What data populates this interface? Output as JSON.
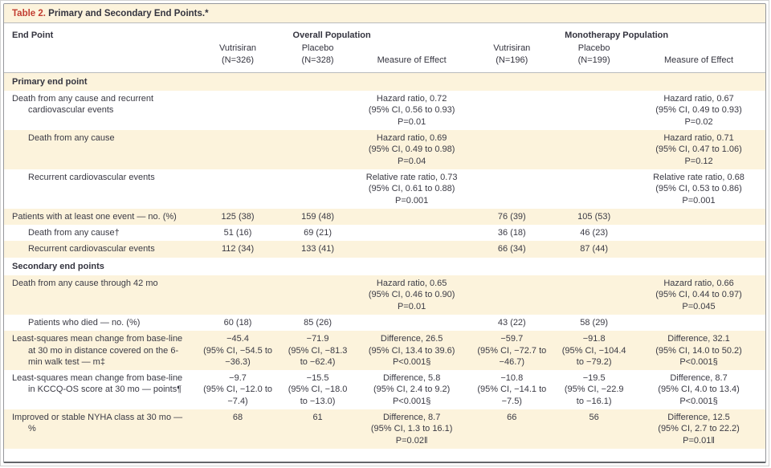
{
  "title": {
    "label": "Table 2.",
    "text": " Primary and Secondary End Points.*"
  },
  "colors": {
    "accent_red": "#c23d31",
    "row_shade": "#fcf3dc",
    "text": "#3a3a44",
    "border": "#95979b"
  },
  "header": {
    "end_point": "End Point",
    "groups": [
      {
        "label": "Overall Population"
      },
      {
        "label": "Monotherapy Population"
      }
    ],
    "columns": [
      "Vutrisiran\n(N=326)",
      "Placebo\n(N=328)",
      "Measure of Effect",
      "Vutrisiran\n(N=196)",
      "Placebo\n(N=199)",
      "Measure of Effect"
    ]
  },
  "rows": [
    {
      "type": "section",
      "label": "Primary end point",
      "shade": true
    },
    {
      "type": "data",
      "indent": 0,
      "shade": false,
      "label": "Death from any cause and recurrent cardiovascular events",
      "cells": [
        "",
        "",
        "Hazard ratio, 0.72\n(95% CI, 0.56 to 0.93)\nP=0.01",
        "",
        "",
        "Hazard ratio, 0.67\n(95% CI, 0.49 to 0.93)\nP=0.02"
      ]
    },
    {
      "type": "data",
      "indent": 1,
      "shade": true,
      "label": "Death from any cause",
      "cells": [
        "",
        "",
        "Hazard ratio, 0.69\n(95% CI, 0.49 to 0.98)\nP=0.04",
        "",
        "",
        "Hazard ratio, 0.71\n(95% CI, 0.47 to 1.06)\nP=0.12"
      ]
    },
    {
      "type": "data",
      "indent": 1,
      "shade": false,
      "label": "Recurrent cardiovascular events",
      "cells": [
        "",
        "",
        "Relative rate ratio, 0.73\n(95% CI, 0.61 to 0.88)\nP=0.001",
        "",
        "",
        "Relative rate ratio, 0.68\n(95% CI, 0.53 to 0.86)\nP=0.001"
      ]
    },
    {
      "type": "data",
      "indent": 0,
      "shade": true,
      "label": "Patients with at least one event — no. (%)",
      "cells": [
        "125 (38)",
        "159 (48)",
        "",
        "76 (39)",
        "105 (53)",
        ""
      ]
    },
    {
      "type": "data",
      "indent": 1,
      "shade": false,
      "label": "Death from any cause†",
      "cells": [
        "51 (16)",
        "69 (21)",
        "",
        "36 (18)",
        "46 (23)",
        ""
      ]
    },
    {
      "type": "data",
      "indent": 1,
      "shade": true,
      "label": "Recurrent cardiovascular events",
      "cells": [
        "112 (34)",
        "133 (41)",
        "",
        "66 (34)",
        "87 (44)",
        ""
      ]
    },
    {
      "type": "section",
      "label": "Secondary end points",
      "shade": false
    },
    {
      "type": "data",
      "indent": 0,
      "shade": true,
      "label": "Death from any cause through 42 mo",
      "cells": [
        "",
        "",
        "Hazard ratio, 0.65\n(95% CI, 0.46 to 0.90)\nP=0.01",
        "",
        "",
        "Hazard ratio, 0.66\n(95% CI, 0.44 to 0.97)\nP=0.045"
      ]
    },
    {
      "type": "data",
      "indent": 1,
      "shade": false,
      "label": "Patients who died — no. (%)",
      "cells": [
        "60 (18)",
        "85 (26)",
        "",
        "43 (22)",
        "58 (29)",
        ""
      ]
    },
    {
      "type": "data",
      "indent": 0,
      "shade": true,
      "label": "Least-squares mean change from base-line at 30 mo in distance covered on the 6-min walk test — m‡",
      "cells": [
        "−45.4\n(95% CI, −54.5 to −36.3)",
        "−71.9\n(95% CI, −81.3 to −62.4)",
        "Difference, 26.5\n(95% CI, 13.4 to 39.6)\nP<0.001§",
        "−59.7\n(95% CI, −72.7 to −46.7)",
        "−91.8\n(95% CI, −104.4 to −79.2)",
        "Difference, 32.1\n(95% CI, 14.0 to 50.2)\nP<0.001§"
      ]
    },
    {
      "type": "data",
      "indent": 0,
      "shade": false,
      "label": "Least-squares mean change from base-line in KCCQ-OS score at 30 mo — points¶",
      "cells": [
        "−9.7\n(95% CI, −12.0 to −7.4)",
        "−15.5\n(95% CI, −18.0 to −13.0)",
        "Difference, 5.8\n(95% CI, 2.4 to 9.2)\nP<0.001§",
        "−10.8\n(95% CI, −14.1 to −7.5)",
        "−19.5\n(95% CI, −22.9 to −16.1)",
        "Difference, 8.7\n(95% CI, 4.0 to 13.4)\nP<0.001§"
      ]
    },
    {
      "type": "data",
      "indent": 0,
      "shade": true,
      "label": "Improved or stable NYHA class at 30 mo — %",
      "cells": [
        "68",
        "61",
        "Difference, 8.7\n(95% CI, 1.3 to 16.1)\nP=0.02‖",
        "66",
        "56",
        "Difference, 12.5\n(95% CI, 2.7 to 22.2)\nP=0.01‖"
      ]
    }
  ]
}
